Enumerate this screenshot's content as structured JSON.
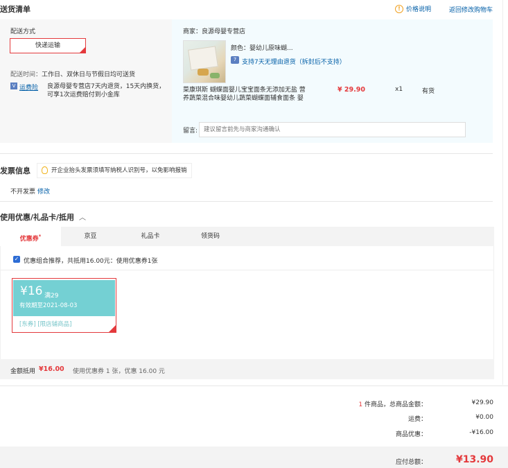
{
  "header": {
    "title": "送货清单",
    "price_info": "价格说明",
    "back_to_cart": "返回修改购物车"
  },
  "delivery": {
    "method_label": "配送方式",
    "method_value": "快递运输",
    "time_label": "配送时间：",
    "time_value": "工作日、双休日与节假日均可送货",
    "insure_link": "运费险",
    "insure_text": "良源母婴专营店7天内退货，15天内换货，可享1次运费赔付到小金库"
  },
  "seller": {
    "name": "商家：良源母婴专营店",
    "color": "颜色：婴幼儿原味蝴...",
    "return_policy": "支持7天无理由退货（拆封后不支持）",
    "product_name": "菜康琪斯 蝴蝶面婴儿宝宝面条无添加无盐 营养蔬菜混合味婴幼儿蔬菜蝴蝶面辅食面条 婴",
    "price": "¥ 29.90",
    "qty": "x1",
    "stock": "有货",
    "remark_label": "留言:",
    "remark_placeholder": "建议留言前先与商家沟通确认"
  },
  "invoice": {
    "title": "发票信息",
    "tip": "开企业抬头发票须填写纳税人识别号，以免影响报销",
    "value": "不开发票",
    "edit": "修改"
  },
  "coupon": {
    "title": "使用优惠/礼品卡/抵用",
    "chevron": "︿",
    "tabs": [
      "优惠券",
      "京豆",
      "礼品卡",
      "领货码"
    ],
    "tab_star": "*",
    "combo_text": "优惠组合推荐，共抵用16.00元：使用优惠券1张",
    "card_amount": "¥16",
    "card_min": "满29",
    "card_expire": "有效期至2021-08-03",
    "card_scope": "[东券] [限店铺商品]",
    "summary_label": "金额抵用",
    "summary_amount": "¥16.00",
    "summary_detail": "使用优惠券 1 张，优惠 16.00 元"
  },
  "totals": {
    "items_count": "1",
    "items_label": " 件商品，总商品金额：",
    "items_value": "¥29.90",
    "shipping_label": "运费：",
    "shipping_value": "¥0.00",
    "discount_label": "商品优惠：",
    "discount_value": "-¥16.00",
    "grand_label": "应付总额：",
    "grand_value": "¥13.90"
  },
  "colors": {
    "accent_red": "#e4393c",
    "link_blue": "#005ea7",
    "coupon_teal": "#74d0d3"
  }
}
